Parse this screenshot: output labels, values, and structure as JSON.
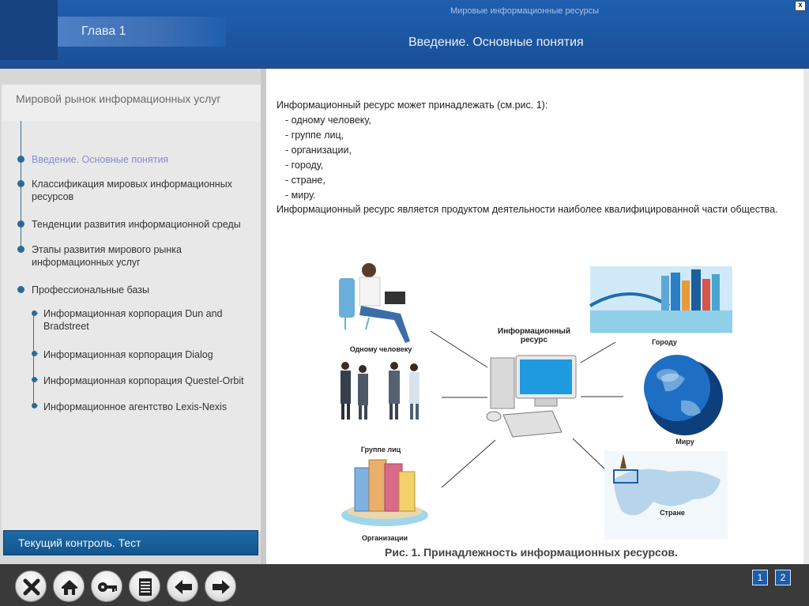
{
  "header": {
    "chapter": "Глава 1",
    "subtitle": "Мировые информационные ресурсы",
    "title": "Введение. Основные понятия",
    "close": "x"
  },
  "sidebar": {
    "section_title": "Мировой рынок информационных услуг",
    "items": [
      {
        "label": "Введение. Основные понятия",
        "active": true
      },
      {
        "label": "Классификация мировых информационных\nресурсов"
      },
      {
        "label": "Тенденции развития информационной среды"
      },
      {
        "label": "Этапы развития мирового рынка\nинформационных услуг"
      },
      {
        "label": "Профессиональные базы"
      }
    ],
    "subitems": [
      {
        "label": "Информационная корпорация Dun and\nBradstreet"
      },
      {
        "label": "Информационная корпорация Dialog"
      },
      {
        "label": "Информационная корпорация Questel-Orbit"
      },
      {
        "label": "Информационное агентство Lexis-Nexis"
      }
    ],
    "test_button": "Текущий контроль. Тест"
  },
  "content": {
    "intro": "Информационный ресурс может принадлежать (см.рис. 1):",
    "list": [
      "- одному человеку,",
      "- группе лиц,",
      "- организации,",
      "- городу,",
      "- стране,",
      "- миру."
    ],
    "paragraph": "Информационный ресурс является продуктом деятельности наиболее квалифицированной части общества.",
    "diagram": {
      "center": "Информационный\nресурс",
      "labels": {
        "person": "Одному человеку",
        "group": "Группе лиц",
        "org": "Организации",
        "city": "Городу",
        "world": "Миру",
        "country": "Стране"
      }
    },
    "caption": "Рис. 1. Принадлежность информационных ресурсов."
  },
  "bottom": {
    "buttons": [
      "close-icon",
      "home-icon",
      "key-icon",
      "notes-icon",
      "back-arrow-icon",
      "forward-arrow-icon"
    ],
    "pages": [
      "1",
      "2"
    ]
  }
}
